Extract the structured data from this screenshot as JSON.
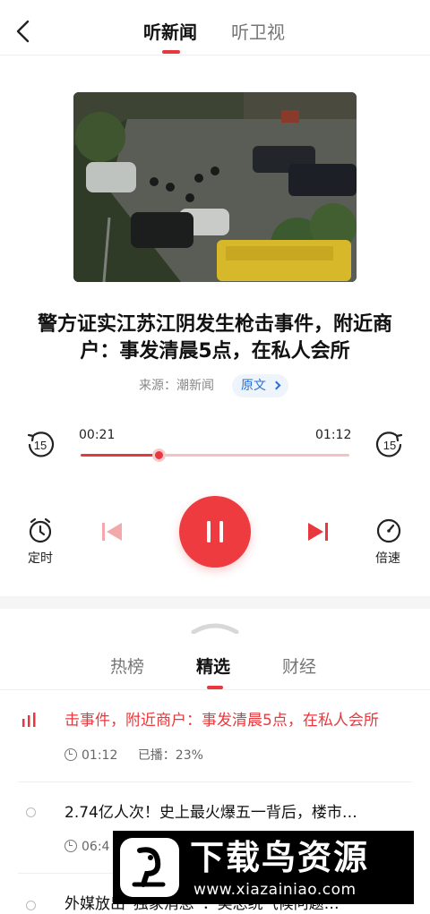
{
  "header": {
    "tabs": [
      {
        "label": "听新闻"
      },
      {
        "label": "听卫视"
      }
    ]
  },
  "article": {
    "title": "警方证实江苏江阴发生枪击事件，附近商户：事发清晨5点，在私人会所",
    "source": "来源：潮新闻",
    "original_label": "原文"
  },
  "player": {
    "current_time": "00:21",
    "total_time": "01:12",
    "progress": 0.29,
    "skip_back_label": "15",
    "skip_forward_label": "15",
    "timer_label": "定时",
    "speed_label": "倍速",
    "state": "playing"
  },
  "list": {
    "tabs": [
      {
        "label": "热榜"
      },
      {
        "label": "精选"
      },
      {
        "label": "财经"
      }
    ],
    "items": [
      {
        "title": "击事件，附近商户：事发清晨5点，在私人会所",
        "duration": "01:12",
        "played": "已播：23%"
      },
      {
        "title": "2.74亿人次！史上最火爆五一背后，楼市…",
        "duration": "06:4"
      },
      {
        "title": "外媒放出“独家消息”：美总统气候问题…"
      }
    ]
  },
  "watermark": {
    "main": "下载鸟资源",
    "url": "www.xiazainiao.com"
  },
  "colors": {
    "accent": "#e8383d",
    "link": "#2a6fd6"
  }
}
